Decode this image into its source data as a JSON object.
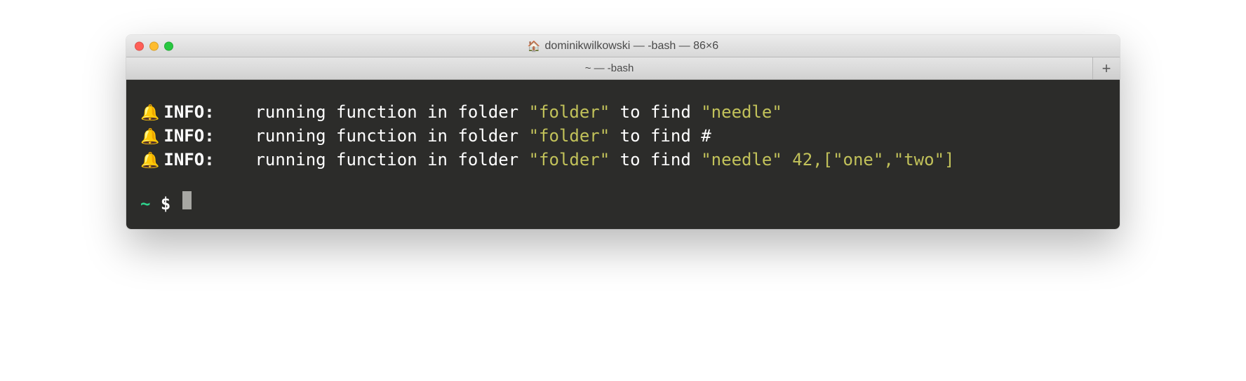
{
  "window": {
    "title_icon": "🏠",
    "title": "dominikwilkowski — -bash — 86×6"
  },
  "tab": {
    "label": "~ — -bash",
    "plus_label": "+"
  },
  "terminal": {
    "prefix": "INFO:    ",
    "plain_before": "running function in folder ",
    "folder": "\"folder\"",
    "plain_mid": " to find ",
    "lines": [
      {
        "bell": "🔔",
        "tail_hl": "\"needle\"",
        "tail_plain": ""
      },
      {
        "bell": "🔔",
        "tail_hl": "",
        "tail_plain": "#"
      },
      {
        "bell": "🔔",
        "tail_hl": "\"needle\" 42,[\"one\",\"two\"]",
        "tail_plain": ""
      }
    ],
    "prompt": {
      "tilde": "~ ",
      "dollar": "$ "
    }
  }
}
